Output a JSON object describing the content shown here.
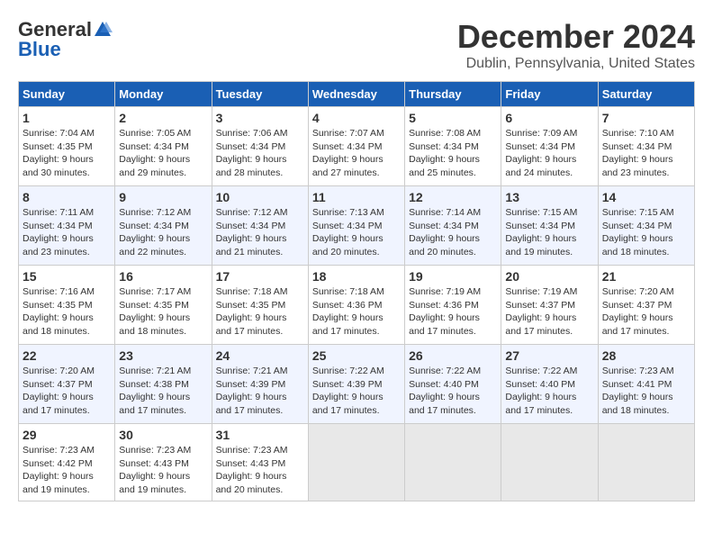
{
  "header": {
    "logo_general": "General",
    "logo_blue": "Blue",
    "title": "December 2024",
    "subtitle": "Dublin, Pennsylvania, United States"
  },
  "days_of_week": [
    "Sunday",
    "Monday",
    "Tuesday",
    "Wednesday",
    "Thursday",
    "Friday",
    "Saturday"
  ],
  "weeks": [
    [
      {
        "day": "1",
        "sunrise": "Sunrise: 7:04 AM",
        "sunset": "Sunset: 4:35 PM",
        "daylight": "Daylight: 9 hours and 30 minutes."
      },
      {
        "day": "2",
        "sunrise": "Sunrise: 7:05 AM",
        "sunset": "Sunset: 4:34 PM",
        "daylight": "Daylight: 9 hours and 29 minutes."
      },
      {
        "day": "3",
        "sunrise": "Sunrise: 7:06 AM",
        "sunset": "Sunset: 4:34 PM",
        "daylight": "Daylight: 9 hours and 28 minutes."
      },
      {
        "day": "4",
        "sunrise": "Sunrise: 7:07 AM",
        "sunset": "Sunset: 4:34 PM",
        "daylight": "Daylight: 9 hours and 27 minutes."
      },
      {
        "day": "5",
        "sunrise": "Sunrise: 7:08 AM",
        "sunset": "Sunset: 4:34 PM",
        "daylight": "Daylight: 9 hours and 25 minutes."
      },
      {
        "day": "6",
        "sunrise": "Sunrise: 7:09 AM",
        "sunset": "Sunset: 4:34 PM",
        "daylight": "Daylight: 9 hours and 24 minutes."
      },
      {
        "day": "7",
        "sunrise": "Sunrise: 7:10 AM",
        "sunset": "Sunset: 4:34 PM",
        "daylight": "Daylight: 9 hours and 23 minutes."
      }
    ],
    [
      {
        "day": "8",
        "sunrise": "Sunrise: 7:11 AM",
        "sunset": "Sunset: 4:34 PM",
        "daylight": "Daylight: 9 hours and 23 minutes."
      },
      {
        "day": "9",
        "sunrise": "Sunrise: 7:12 AM",
        "sunset": "Sunset: 4:34 PM",
        "daylight": "Daylight: 9 hours and 22 minutes."
      },
      {
        "day": "10",
        "sunrise": "Sunrise: 7:12 AM",
        "sunset": "Sunset: 4:34 PM",
        "daylight": "Daylight: 9 hours and 21 minutes."
      },
      {
        "day": "11",
        "sunrise": "Sunrise: 7:13 AM",
        "sunset": "Sunset: 4:34 PM",
        "daylight": "Daylight: 9 hours and 20 minutes."
      },
      {
        "day": "12",
        "sunrise": "Sunrise: 7:14 AM",
        "sunset": "Sunset: 4:34 PM",
        "daylight": "Daylight: 9 hours and 20 minutes."
      },
      {
        "day": "13",
        "sunrise": "Sunrise: 7:15 AM",
        "sunset": "Sunset: 4:34 PM",
        "daylight": "Daylight: 9 hours and 19 minutes."
      },
      {
        "day": "14",
        "sunrise": "Sunrise: 7:15 AM",
        "sunset": "Sunset: 4:34 PM",
        "daylight": "Daylight: 9 hours and 18 minutes."
      }
    ],
    [
      {
        "day": "15",
        "sunrise": "Sunrise: 7:16 AM",
        "sunset": "Sunset: 4:35 PM",
        "daylight": "Daylight: 9 hours and 18 minutes."
      },
      {
        "day": "16",
        "sunrise": "Sunrise: 7:17 AM",
        "sunset": "Sunset: 4:35 PM",
        "daylight": "Daylight: 9 hours and 18 minutes."
      },
      {
        "day": "17",
        "sunrise": "Sunrise: 7:18 AM",
        "sunset": "Sunset: 4:35 PM",
        "daylight": "Daylight: 9 hours and 17 minutes."
      },
      {
        "day": "18",
        "sunrise": "Sunrise: 7:18 AM",
        "sunset": "Sunset: 4:36 PM",
        "daylight": "Daylight: 9 hours and 17 minutes."
      },
      {
        "day": "19",
        "sunrise": "Sunrise: 7:19 AM",
        "sunset": "Sunset: 4:36 PM",
        "daylight": "Daylight: 9 hours and 17 minutes."
      },
      {
        "day": "20",
        "sunrise": "Sunrise: 7:19 AM",
        "sunset": "Sunset: 4:37 PM",
        "daylight": "Daylight: 9 hours and 17 minutes."
      },
      {
        "day": "21",
        "sunrise": "Sunrise: 7:20 AM",
        "sunset": "Sunset: 4:37 PM",
        "daylight": "Daylight: 9 hours and 17 minutes."
      }
    ],
    [
      {
        "day": "22",
        "sunrise": "Sunrise: 7:20 AM",
        "sunset": "Sunset: 4:37 PM",
        "daylight": "Daylight: 9 hours and 17 minutes."
      },
      {
        "day": "23",
        "sunrise": "Sunrise: 7:21 AM",
        "sunset": "Sunset: 4:38 PM",
        "daylight": "Daylight: 9 hours and 17 minutes."
      },
      {
        "day": "24",
        "sunrise": "Sunrise: 7:21 AM",
        "sunset": "Sunset: 4:39 PM",
        "daylight": "Daylight: 9 hours and 17 minutes."
      },
      {
        "day": "25",
        "sunrise": "Sunrise: 7:22 AM",
        "sunset": "Sunset: 4:39 PM",
        "daylight": "Daylight: 9 hours and 17 minutes."
      },
      {
        "day": "26",
        "sunrise": "Sunrise: 7:22 AM",
        "sunset": "Sunset: 4:40 PM",
        "daylight": "Daylight: 9 hours and 17 minutes."
      },
      {
        "day": "27",
        "sunrise": "Sunrise: 7:22 AM",
        "sunset": "Sunset: 4:40 PM",
        "daylight": "Daylight: 9 hours and 17 minutes."
      },
      {
        "day": "28",
        "sunrise": "Sunrise: 7:23 AM",
        "sunset": "Sunset: 4:41 PM",
        "daylight": "Daylight: 9 hours and 18 minutes."
      }
    ],
    [
      {
        "day": "29",
        "sunrise": "Sunrise: 7:23 AM",
        "sunset": "Sunset: 4:42 PM",
        "daylight": "Daylight: 9 hours and 19 minutes."
      },
      {
        "day": "30",
        "sunrise": "Sunrise: 7:23 AM",
        "sunset": "Sunset: 4:43 PM",
        "daylight": "Daylight: 9 hours and 19 minutes."
      },
      {
        "day": "31",
        "sunrise": "Sunrise: 7:23 AM",
        "sunset": "Sunset: 4:43 PM",
        "daylight": "Daylight: 9 hours and 20 minutes."
      },
      null,
      null,
      null,
      null
    ]
  ]
}
